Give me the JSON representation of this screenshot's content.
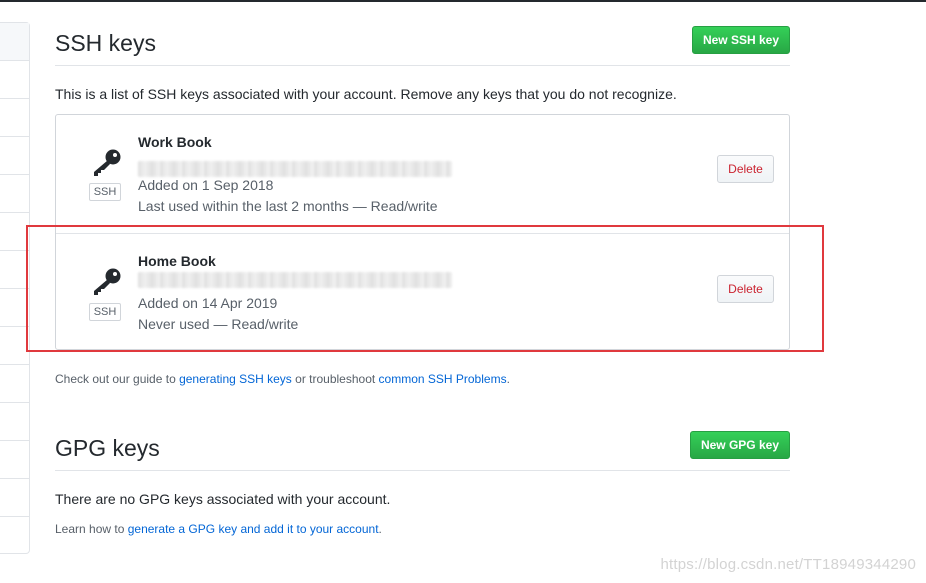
{
  "ssh": {
    "heading": "SSH keys",
    "new_button": "New SSH key",
    "intro": "This is a list of SSH keys associated with your account. Remove any keys that you do not recognize.",
    "keys": [
      {
        "title": "Work Book",
        "badge": "SSH",
        "added": "Added on 1 Sep 2018",
        "usage": "Last used within the last 2 months — Read/write",
        "delete_label": "Delete"
      },
      {
        "title": "Home Book",
        "badge": "SSH",
        "added": "Added on 14 Apr 2019",
        "usage": "Never used — Read/write",
        "delete_label": "Delete"
      }
    ],
    "help": {
      "prefix": "Check out our guide to ",
      "link1": "generating SSH keys",
      "middle": " or troubleshoot ",
      "link2": "common SSH Problems",
      "suffix": "."
    }
  },
  "gpg": {
    "heading": "GPG keys",
    "new_button": "New GPG key",
    "empty_text": "There are no GPG keys associated with your account.",
    "help": {
      "prefix": "Learn how to ",
      "link": "generate a GPG key and add it to your account",
      "suffix": "."
    }
  },
  "watermark": "https://blog.csdn.net/TT18949344290",
  "colors": {
    "accent_green": "#28a745",
    "link_blue": "#0366d6",
    "delete_red": "#cb2431",
    "highlight_red": "#e0393e"
  },
  "icons": [
    "key-icon"
  ]
}
